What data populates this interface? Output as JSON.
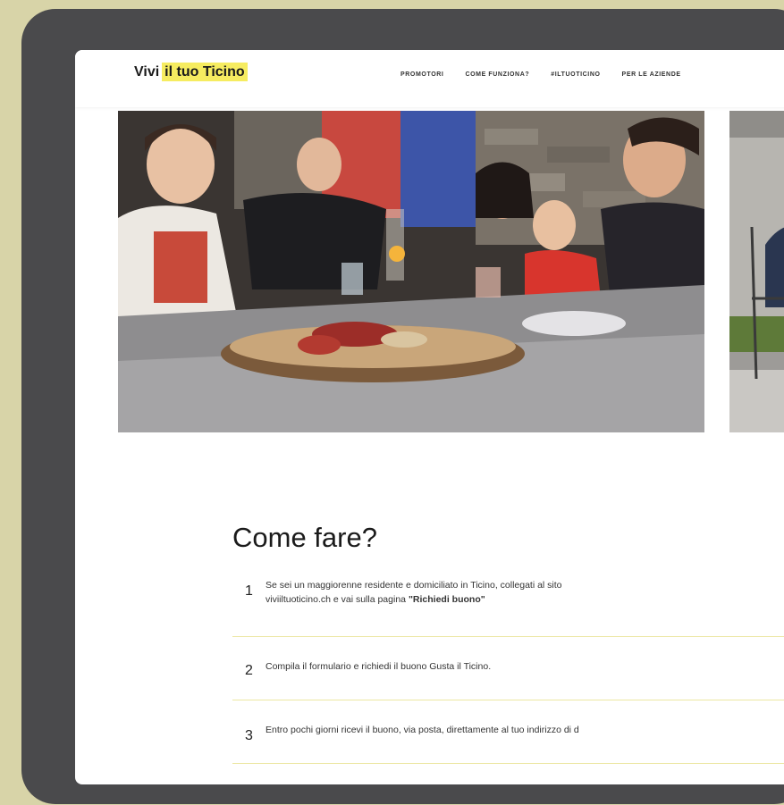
{
  "logo": {
    "text_part1": "Vivi",
    "text_highlight": "il tuo Ticino"
  },
  "nav": {
    "items": [
      "PROMOTORI",
      "COME FUNZIONA?",
      "#ILTUOTICINO",
      "PER LE AZIENDE"
    ]
  },
  "section": {
    "title": "Come fare?",
    "steps": [
      {
        "number": "1",
        "line1": "Se sei un maggiorenne residente e domiciliato in Ticino, collegati al sito",
        "line2_start": "viviiltuoticino.ch e vai sulla pagina",
        "line2_bold": "\"Richiedi buono\"",
        "line2_end": ""
      },
      {
        "number": "2",
        "text": "Compila il formulario e richiedi il buono Gusta il Ticino."
      },
      {
        "number": "3",
        "text": "Entro pochi giorni ricevi il buono, via posta, direttamente al tuo indirizzo di d"
      }
    ]
  },
  "colors": {
    "background": "#d8d4a8",
    "device_frame": "#4a4a4c",
    "logo_highlight": "#f6ec60",
    "divider": "#ece7a3"
  }
}
